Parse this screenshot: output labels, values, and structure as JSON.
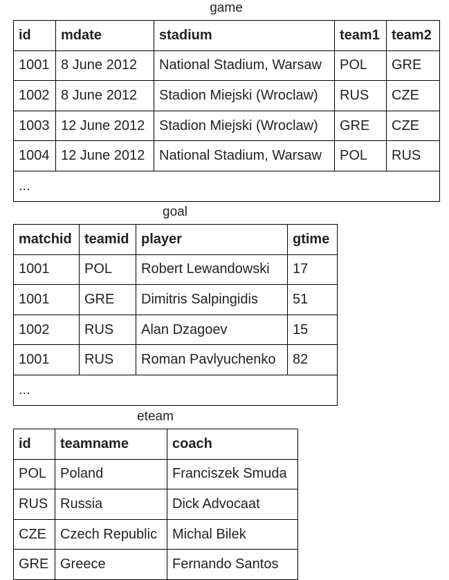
{
  "game": {
    "caption": "game",
    "headers": [
      "id",
      "mdate",
      "stadium",
      "team1",
      "team2"
    ],
    "rows": [
      [
        "1001",
        "8 June 2012",
        "National Stadium, Warsaw",
        "POL",
        "GRE"
      ],
      [
        "1002",
        "8 June 2012",
        "Stadion Miejski (Wroclaw)",
        "RUS",
        "CZE"
      ],
      [
        "1003",
        "12 June 2012",
        "Stadion Miejski (Wroclaw)",
        "GRE",
        "CZE"
      ],
      [
        "1004",
        "12 June 2012",
        "National Stadium, Warsaw",
        "POL",
        "RUS"
      ]
    ],
    "ellipsis": "..."
  },
  "goal": {
    "caption": "goal",
    "headers": [
      "matchid",
      "teamid",
      "player",
      "gtime"
    ],
    "rows": [
      [
        "1001",
        "POL",
        "Robert Lewandowski",
        "17"
      ],
      [
        "1001",
        "GRE",
        "Dimitris Salpingidis",
        "51"
      ],
      [
        "1002",
        "RUS",
        "Alan Dzagoev",
        "15"
      ],
      [
        "1001",
        "RUS",
        "Roman Pavlyuchenko",
        "82"
      ]
    ],
    "ellipsis": "..."
  },
  "eteam": {
    "caption": "eteam",
    "headers": [
      "id",
      "teamname",
      "coach"
    ],
    "rows": [
      [
        "POL",
        "Poland",
        "Franciszek Smuda"
      ],
      [
        "RUS",
        "Russia",
        "Dick Advocaat"
      ],
      [
        "CZE",
        "Czech Republic",
        "Michal Bilek"
      ],
      [
        "GRE",
        "Greece",
        "Fernando Santos"
      ]
    ]
  }
}
